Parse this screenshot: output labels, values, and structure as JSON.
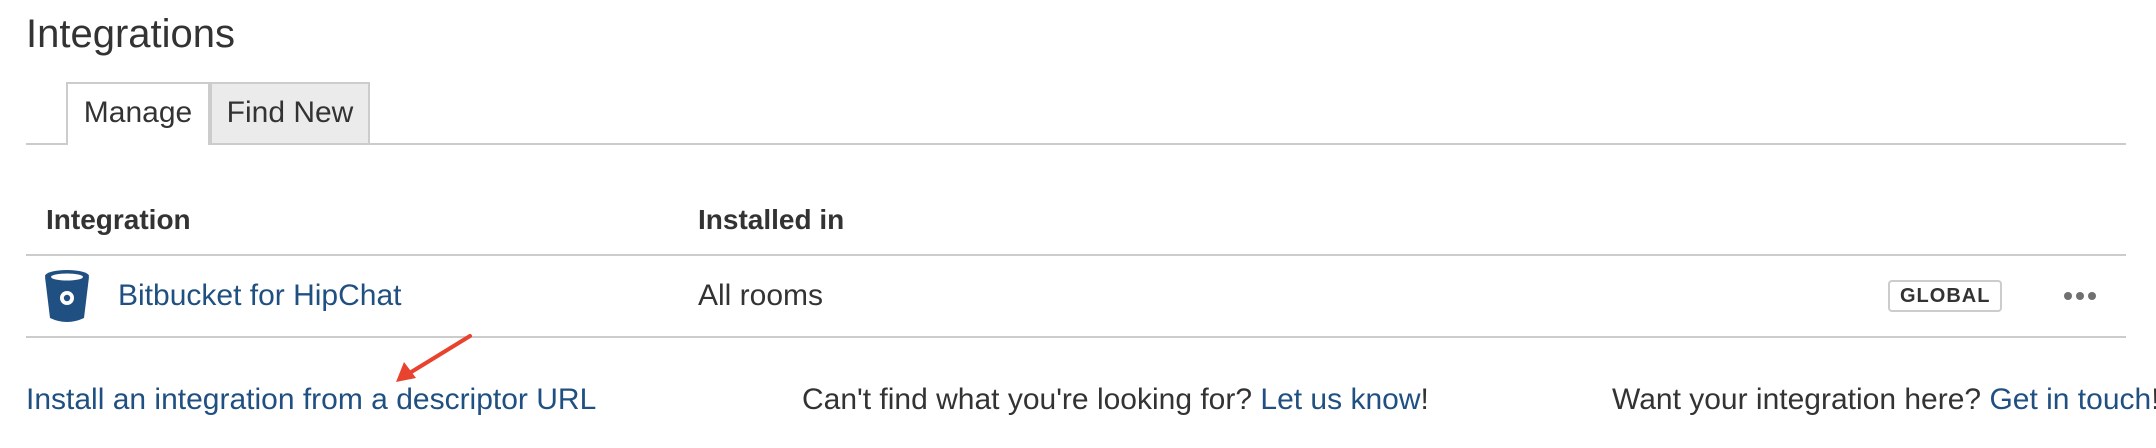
{
  "page": {
    "title": "Integrations"
  },
  "tabs": [
    {
      "label": "Manage",
      "active": true
    },
    {
      "label": "Find New",
      "active": false
    }
  ],
  "table": {
    "columns": [
      "Integration",
      "Installed in"
    ],
    "rows": [
      {
        "icon": "bitbucket-icon",
        "name": "Bitbucket for HipChat",
        "installed_in": "All rooms",
        "scope_badge": "GLOBAL",
        "actions_icon": "more-icon"
      }
    ]
  },
  "footer": {
    "install_link": "Install an integration from a descriptor URL",
    "cant_find_text": "Can't find what you're looking for? ",
    "cant_find_link": "Let us know",
    "cant_find_suffix": "!",
    "want_text": "Want your integration here? ",
    "want_link": "Get in touch",
    "want_suffix": "!"
  },
  "colors": {
    "link": "#205081",
    "text": "#333333",
    "border": "#cccccc",
    "inactive_tab": "#ebebeb",
    "annotation_arrow": "#e8432f"
  }
}
